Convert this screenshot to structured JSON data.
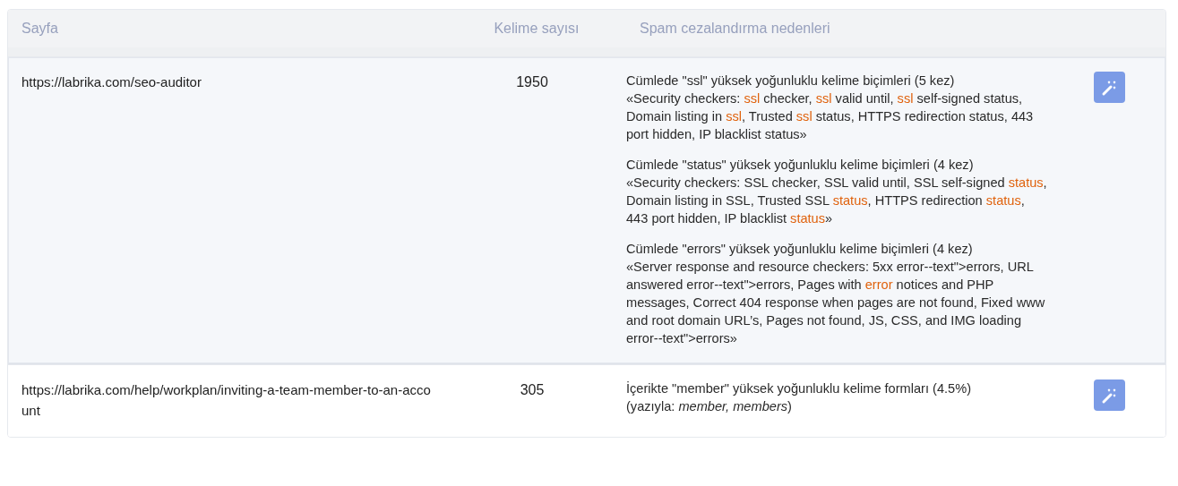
{
  "table": {
    "columns": [
      "Sayfa",
      "Kelime sayısı",
      "Spam cezalandırma nedenleri"
    ],
    "rows": [
      {
        "selected": true,
        "page": "https://labrika.com/seo-auditor",
        "word_count": "1950",
        "reasons": [
          {
            "title": "Cümlede \"ssl\" yüksek yoğunluklu kelime biçimleri (5 kez)",
            "quote": [
              {
                "text": "«Security checkers: ",
                "highlight": false
              },
              {
                "text": "ssl",
                "highlight": true
              },
              {
                "text": " checker, ",
                "highlight": false
              },
              {
                "text": "ssl",
                "highlight": true
              },
              {
                "text": " valid until, ",
                "highlight": false
              },
              {
                "text": "ssl",
                "highlight": true
              },
              {
                "text": " self-signed status, Domain listing in ",
                "highlight": false
              },
              {
                "text": "ssl",
                "highlight": true
              },
              {
                "text": ", Trusted ",
                "highlight": false
              },
              {
                "text": "ssl",
                "highlight": true
              },
              {
                "text": " status, HTTPS redirection status, 443 port hidden, IP blacklist status»",
                "highlight": false
              }
            ]
          },
          {
            "title": "Cümlede \"status\" yüksek yoğunluklu kelime biçimleri (4 kez)",
            "quote": [
              {
                "text": "«Security checkers: SSL checker, SSL valid until, SSL self-signed ",
                "highlight": false
              },
              {
                "text": "status",
                "highlight": true
              },
              {
                "text": ", Domain listing in SSL, Trusted SSL ",
                "highlight": false
              },
              {
                "text": "status",
                "highlight": true
              },
              {
                "text": ", HTTPS redirection ",
                "highlight": false
              },
              {
                "text": "status",
                "highlight": true
              },
              {
                "text": ", 443 port hidden, IP blacklist ",
                "highlight": false
              },
              {
                "text": "status",
                "highlight": true
              },
              {
                "text": "»",
                "highlight": false
              }
            ]
          },
          {
            "title": "Cümlede \"errors\" yüksek yoğunluklu kelime biçimleri (4 kez)",
            "quote": [
              {
                "text": "«Server response and resource checkers: 5xx error--text\">errors, URL answered error--text\">errors, Pages with ",
                "highlight": false
              },
              {
                "text": "error",
                "highlight": true
              },
              {
                "text": " notices and PHP messages, Correct 404 response when pages are not found, Fixed www and root domain URL’s, Pages not found, JS, CSS, and IMG loading error--text\">errors»",
                "highlight": false
              }
            ]
          }
        ]
      },
      {
        "selected": false,
        "page": "https://labrika.com/help/workplan/inviting-a-team-member-to-an-account",
        "word_count": "305",
        "reasons": [
          {
            "title": "İçerikte \"member\" yüksek yoğunluklu kelime formları (4.5%)",
            "quote": [
              {
                "text": "(yazıyla: *member, members*)",
                "highlight": false
              }
            ]
          }
        ]
      }
    ]
  }
}
